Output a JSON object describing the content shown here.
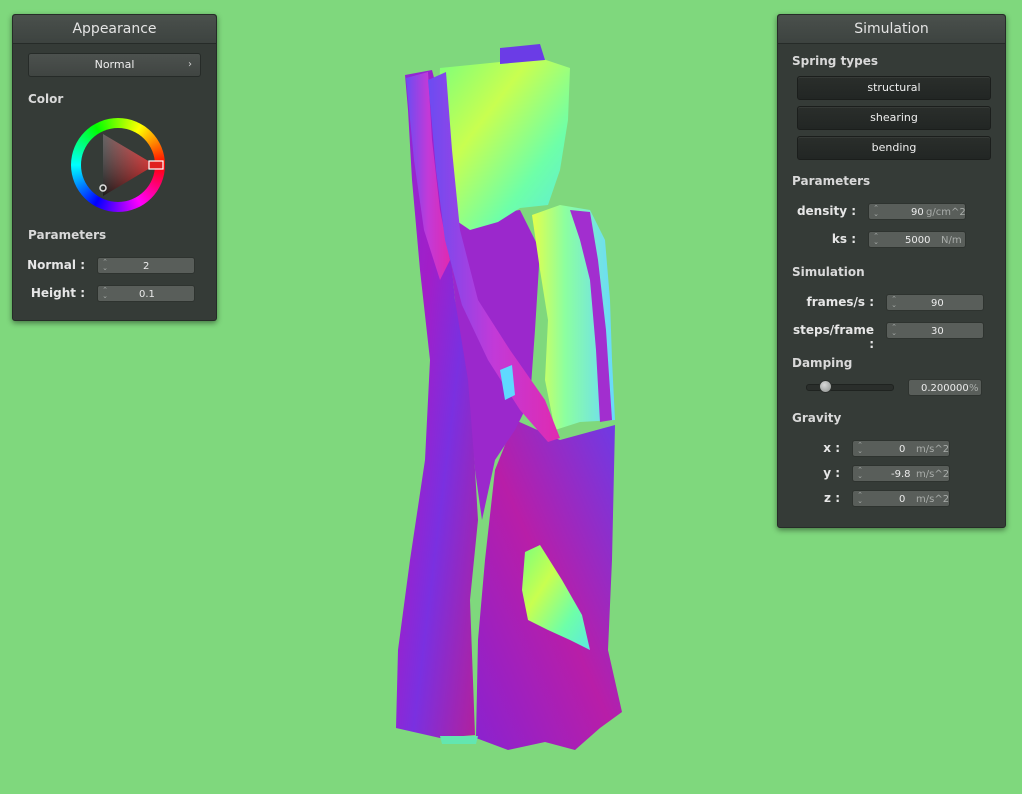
{
  "appearance": {
    "title": "Appearance",
    "shader_value": "Normal",
    "chevron_icon": "chevron-right-icon",
    "color_label": "Color",
    "parameters_label": "Parameters",
    "normal_label": "Normal :",
    "normal_value": "2",
    "height_label": "Height :",
    "height_value": "0.1"
  },
  "simulation": {
    "title": "Simulation",
    "spring_types_label": "Spring types",
    "spring_buttons": [
      "structural",
      "shearing",
      "bending"
    ],
    "parameters_label": "Parameters",
    "density_label": "density :",
    "density_value": "90",
    "density_unit": "g/cm^2",
    "ks_label": "ks :",
    "ks_value": "5000",
    "ks_unit": "N/m",
    "simulation_label": "Simulation",
    "fps_label": "frames/s :",
    "fps_value": "90",
    "steps_label": "steps/frame :",
    "steps_value": "30",
    "damping_label": "Damping",
    "damping_value": "0.200000",
    "damping_unit": "%",
    "damping_fraction": 0.2,
    "gravity_label": "Gravity",
    "gx_label": "x :",
    "gx_value": "0",
    "gy_label": "y :",
    "gy_value": "-9.8",
    "gz_label": "z :",
    "gz_value": "0",
    "gravity_unit": "m/s^2"
  },
  "colors": {
    "background": "#7fd87d",
    "panel": "#353b37"
  }
}
